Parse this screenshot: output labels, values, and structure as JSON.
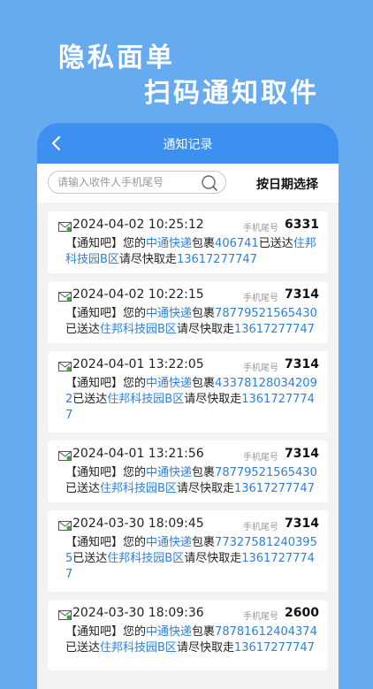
{
  "promo": {
    "line1": "隐私面单",
    "line2": "扫码通知取件"
  },
  "navbar": {
    "title": "通知记录"
  },
  "search": {
    "placeholder": "请输入收件人手机尾号",
    "date_button": "按日期选择"
  },
  "colors": {
    "background": "#66aaf0",
    "navbar": "#3d8ff0",
    "link_blue": "#2f80d6"
  },
  "records": [
    {
      "time": "2024-04-02 10:25:12",
      "tail_label": "手机尾号",
      "tail": "6331",
      "prefix": "【通知吧】您的",
      "courier": "中通快递",
      "mid": "包裹",
      "tracking": "406741",
      "sent": "已送达",
      "location": "住邦科技园B区",
      "suffix": "请尽快取走",
      "phone": "13617277747"
    },
    {
      "time": "2024-04-02 10:22:15",
      "tail_label": "手机尾号",
      "tail": "7314",
      "prefix": "【通知吧】您的",
      "courier": "中通快递",
      "mid": "包裹",
      "tracking": "78779521565430",
      "sent": "已送达",
      "location": "住邦科技园B区",
      "suffix": "请尽快取走",
      "phone": "13617277747"
    },
    {
      "time": "2024-04-01 13:22:05",
      "tail_label": "手机尾号",
      "tail": "7314",
      "prefix": "【通知吧】您的",
      "courier": "中通快递",
      "mid": "包裹",
      "tracking": "433781280342092",
      "sent": "已送达",
      "location": "住邦科技园B区",
      "suffix": "请尽快取走",
      "phone": "13617277747"
    },
    {
      "time": "2024-04-01 13:21:56",
      "tail_label": "手机尾号",
      "tail": "7314",
      "prefix": "【通知吧】您的",
      "courier": "中通快递",
      "mid": "包裹",
      "tracking": "78779521565430",
      "sent": "已送达",
      "location": "住邦科技园B区",
      "suffix": "请尽快取走",
      "phone": "13617277747"
    },
    {
      "time": "2024-03-30 18:09:45",
      "tail_label": "手机尾号",
      "tail": "7314",
      "prefix": "【通知吧】您的",
      "courier": "中通快递",
      "mid": "包裹",
      "tracking": "773275812403955",
      "sent": "已送达",
      "location": "住邦科技园B区",
      "suffix": "请尽快取走",
      "phone": "13617277747"
    },
    {
      "time": "2024-03-30 18:09:36",
      "tail_label": "手机尾号",
      "tail": "2600",
      "prefix": "【通知吧】您的",
      "courier": "中通快递",
      "mid": "包裹",
      "tracking": "78781612404374",
      "sent": "已送达",
      "location": "住邦科技园B区",
      "suffix": "请尽快取走",
      "phone": "13617277747"
    }
  ]
}
